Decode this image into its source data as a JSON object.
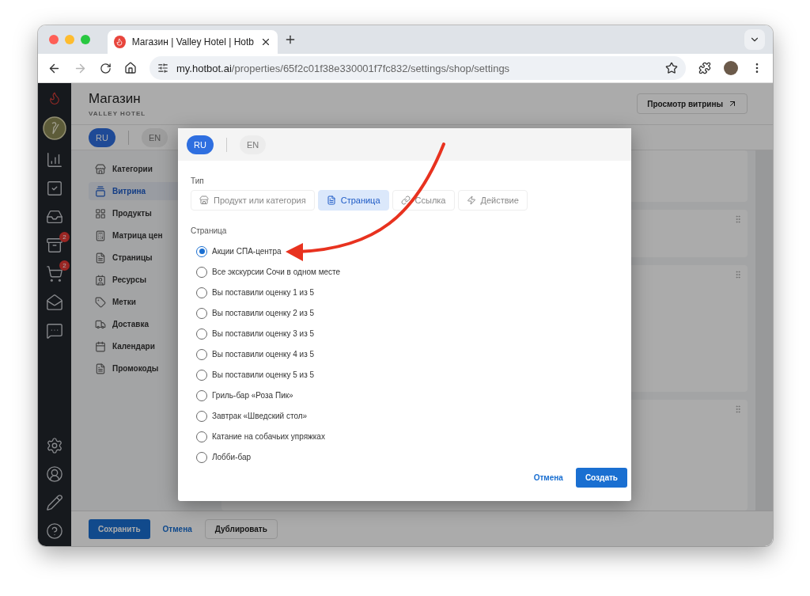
{
  "browser": {
    "tab_title": "Магазин | Valley Hotel | Hotb",
    "url": "**my.hotbot.ai**/properties/65f2c01f38e330001f7fc832/settings/shop/settings",
    "forward_disabled": true
  },
  "rail": {
    "items": [
      {
        "kind": "analytics"
      },
      {
        "kind": "tasks"
      },
      {
        "kind": "inbox"
      },
      {
        "kind": "reviews",
        "badge": "2"
      },
      {
        "kind": "orders",
        "badge": "2"
      },
      {
        "kind": "mailing"
      },
      {
        "kind": "chat"
      }
    ],
    "bottom": [
      {
        "kind": "settings"
      },
      {
        "kind": "profile"
      },
      {
        "kind": "edit"
      },
      {
        "kind": "help"
      }
    ]
  },
  "header": {
    "title": "Магазин",
    "subtitle": "VALLEY HOTEL",
    "preview_button": "Просмотр витрины"
  },
  "languages": [
    {
      "label": "RU",
      "selected": true
    },
    {
      "label": "EN",
      "selected": false
    }
  ],
  "nav": [
    {
      "label": "Категории",
      "kind": "categories",
      "selected": false
    },
    {
      "label": "Витрина",
      "kind": "showcase",
      "selected": true
    },
    {
      "label": "Продукты",
      "kind": "products",
      "selected": false
    },
    {
      "label": "Матрица цен",
      "kind": "prices",
      "selected": false
    },
    {
      "label": "Страницы",
      "kind": "pages",
      "selected": false
    },
    {
      "label": "Ресурсы",
      "kind": "resources",
      "selected": false
    },
    {
      "label": "Метки",
      "kind": "tags",
      "selected": false
    },
    {
      "label": "Доставка",
      "kind": "delivery",
      "selected": false
    },
    {
      "label": "Календари",
      "kind": "calendars",
      "selected": false
    },
    {
      "label": "Промокоды",
      "kind": "promo",
      "selected": false
    }
  ],
  "footer": {
    "save": "Сохранить",
    "cancel": "Отмена",
    "duplicate": "Дублировать"
  },
  "modal": {
    "languages": [
      {
        "label": "RU",
        "selected": true
      },
      {
        "label": "EN",
        "selected": false
      }
    ],
    "type_label": "Тип",
    "types": [
      {
        "label": "Продукт или категория",
        "kind": "product",
        "selected": false
      },
      {
        "label": "Страница",
        "kind": "page",
        "selected": true
      },
      {
        "label": "Ссылка",
        "kind": "link",
        "selected": false
      },
      {
        "label": "Действие",
        "kind": "action",
        "selected": false
      }
    ],
    "page_label": "Страница",
    "pages": [
      {
        "label": "Акции СПА-центра",
        "selected": true
      },
      {
        "label": "Все экскурсии Сочи в одном месте",
        "selected": false
      },
      {
        "label": "Вы поставили оценку 1 из 5",
        "selected": false
      },
      {
        "label": "Вы поставили оценку 2 из 5",
        "selected": false
      },
      {
        "label": "Вы поставили оценку 3 из 5",
        "selected": false
      },
      {
        "label": "Вы поставили оценку 4 из 5",
        "selected": false
      },
      {
        "label": "Вы поставили оценку 5 из 5",
        "selected": false
      },
      {
        "label": "Гриль-бар «Роза Пик»",
        "selected": false
      },
      {
        "label": "Завтрак «Шведский стол»",
        "selected": false
      },
      {
        "label": "Катание на собачьих упряжках",
        "selected": false
      },
      {
        "label": "Лобби-бар",
        "selected": false
      }
    ],
    "cancel": "Отмена",
    "create": "Создать"
  }
}
